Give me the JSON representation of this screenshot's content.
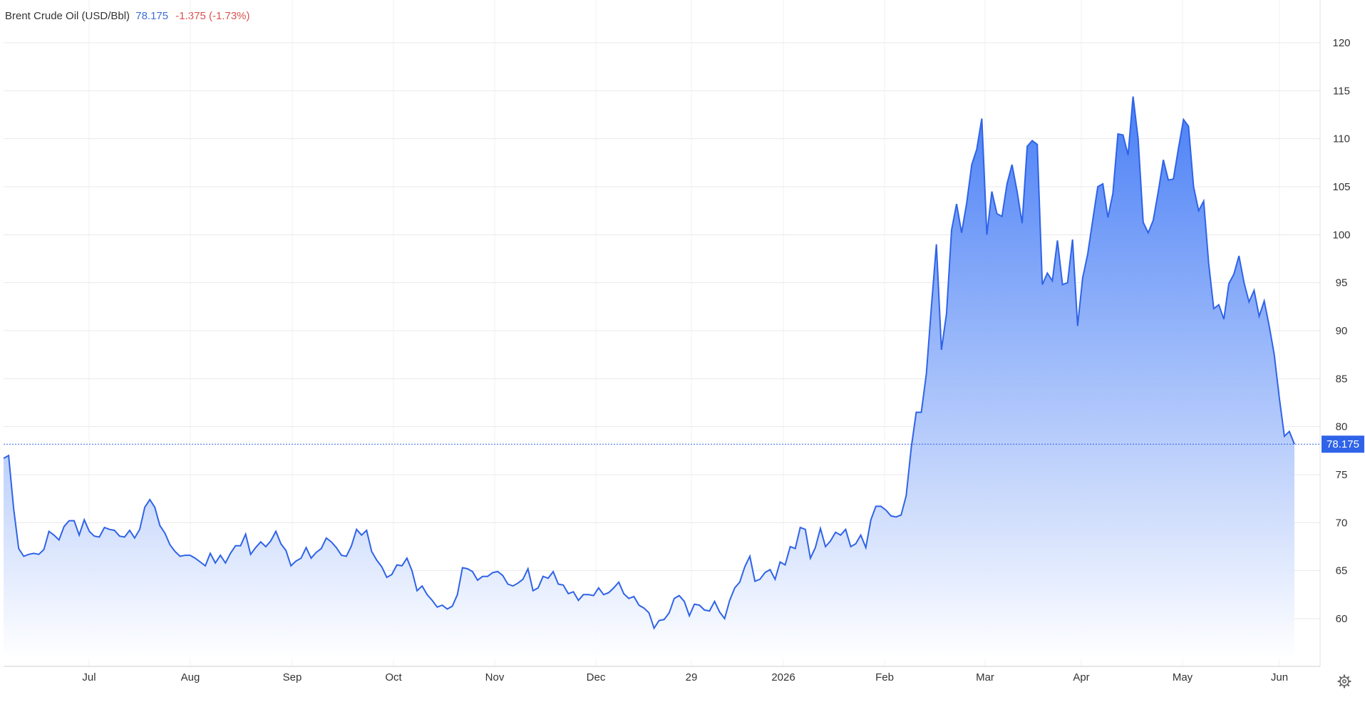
{
  "legend": {
    "name": "Brent Crude Oil (USD/Bbl)",
    "price": "78.175",
    "change": "-1.375 (-1.73%)"
  },
  "price_tag": "78.175",
  "colors": {
    "line": "#2f63e8",
    "fill_top": "#3f78f5",
    "fill_bottom": "#ffffff",
    "grid": "#e8e8e8",
    "price_tag": "#2f63e8",
    "negative": "#d9534f"
  },
  "icons": {
    "settings": "gear-icon"
  },
  "chart_data": {
    "type": "area",
    "title": "Brent Crude Oil (USD/Bbl)",
    "xlabel": "",
    "ylabel": "",
    "ylim": [
      55,
      122
    ],
    "grid": true,
    "y_ticks": [
      60,
      65,
      70,
      75,
      80,
      85,
      90,
      95,
      100,
      105,
      110,
      115,
      120
    ],
    "x_tick_labels": [
      "Jul",
      "Aug",
      "Sep",
      "Oct",
      "Nov",
      "Dec",
      "29",
      "2026",
      "Feb",
      "Mar",
      "Apr",
      "May",
      "Jun"
    ],
    "last_value": 78.175,
    "series": [
      {
        "values": [
          76.7,
          77.0,
          71.5,
          67.3,
          66.5,
          66.7,
          66.8,
          66.7,
          67.2,
          69.1,
          68.7,
          68.2,
          69.6,
          70.2,
          70.2,
          68.7,
          70.3,
          69.1,
          68.6,
          68.5,
          69.5,
          69.3,
          69.2,
          68.6,
          68.5,
          69.2,
          68.4,
          69.3,
          71.6,
          72.4,
          71.6,
          69.7,
          68.9,
          67.7,
          67.0,
          66.5,
          66.6,
          66.6,
          66.3,
          65.9,
          65.5,
          66.8,
          65.8,
          66.6,
          65.8,
          66.8,
          67.6,
          67.6,
          68.8,
          66.7,
          67.4,
          68.0,
          67.5,
          68.1,
          69.1,
          67.8,
          67.1,
          65.5,
          66.0,
          66.3,
          67.4,
          66.3,
          66.9,
          67.3,
          68.4,
          68.0,
          67.4,
          66.6,
          66.5,
          67.6,
          69.3,
          68.7,
          69.2,
          67.0,
          66.1,
          65.4,
          64.3,
          64.6,
          65.6,
          65.5,
          66.3,
          65.0,
          62.9,
          63.4,
          62.5,
          61.9,
          61.2,
          61.4,
          61.0,
          61.3,
          62.5,
          65.3,
          65.2,
          64.9,
          64.0,
          64.4,
          64.4,
          64.8,
          64.9,
          64.5,
          63.6,
          63.4,
          63.7,
          64.1,
          65.2,
          62.9,
          63.2,
          64.4,
          64.2,
          64.9,
          63.6,
          63.5,
          62.6,
          62.8,
          61.9,
          62.5,
          62.5,
          62.4,
          63.2,
          62.5,
          62.7,
          63.2,
          63.8,
          62.6,
          62.1,
          62.3,
          61.4,
          61.1,
          60.6,
          59.0,
          59.8,
          59.9,
          60.6,
          62.1,
          62.4,
          61.8,
          60.3,
          61.5,
          61.4,
          60.9,
          60.8,
          61.8,
          60.7,
          60.0,
          61.9,
          63.2,
          63.8,
          65.4,
          66.5,
          63.9,
          64.1,
          64.8,
          65.1,
          64.1,
          65.9,
          65.6,
          67.5,
          67.3,
          69.5,
          69.3,
          66.3,
          67.4,
          69.4,
          67.5,
          68.1,
          69.0,
          68.7,
          69.3,
          67.5,
          67.8,
          68.7,
          67.4,
          70.3,
          71.7,
          71.7,
          71.3,
          70.7,
          70.6,
          70.8,
          72.8,
          77.8,
          81.5,
          81.5,
          85.5,
          92.5,
          99.0,
          88.0,
          91.8,
          100.5,
          103.2,
          100.2,
          103.3,
          107.3,
          108.9,
          112.1,
          100.0,
          104.5,
          102.2,
          101.9,
          105.3,
          107.3,
          104.5,
          101.2,
          109.2,
          109.8,
          109.4,
          94.8,
          96.0,
          95.2,
          99.4,
          94.8,
          95.0,
          99.5,
          90.5,
          95.5,
          98.0,
          101.5,
          105.0,
          105.3,
          101.8,
          104.3,
          110.5,
          110.4,
          108.3,
          114.4,
          110.0,
          101.3,
          100.2,
          101.5,
          104.5,
          107.8,
          105.7,
          105.8,
          109.0,
          112.0,
          111.3,
          105.0,
          102.5,
          103.5,
          97.0,
          92.3,
          92.7,
          91.2,
          94.9,
          95.9,
          97.8,
          95.0,
          93.0,
          94.2,
          91.5,
          93.1,
          90.5,
          87.5,
          83.0,
          79.0,
          79.5,
          78.175
        ]
      }
    ]
  }
}
